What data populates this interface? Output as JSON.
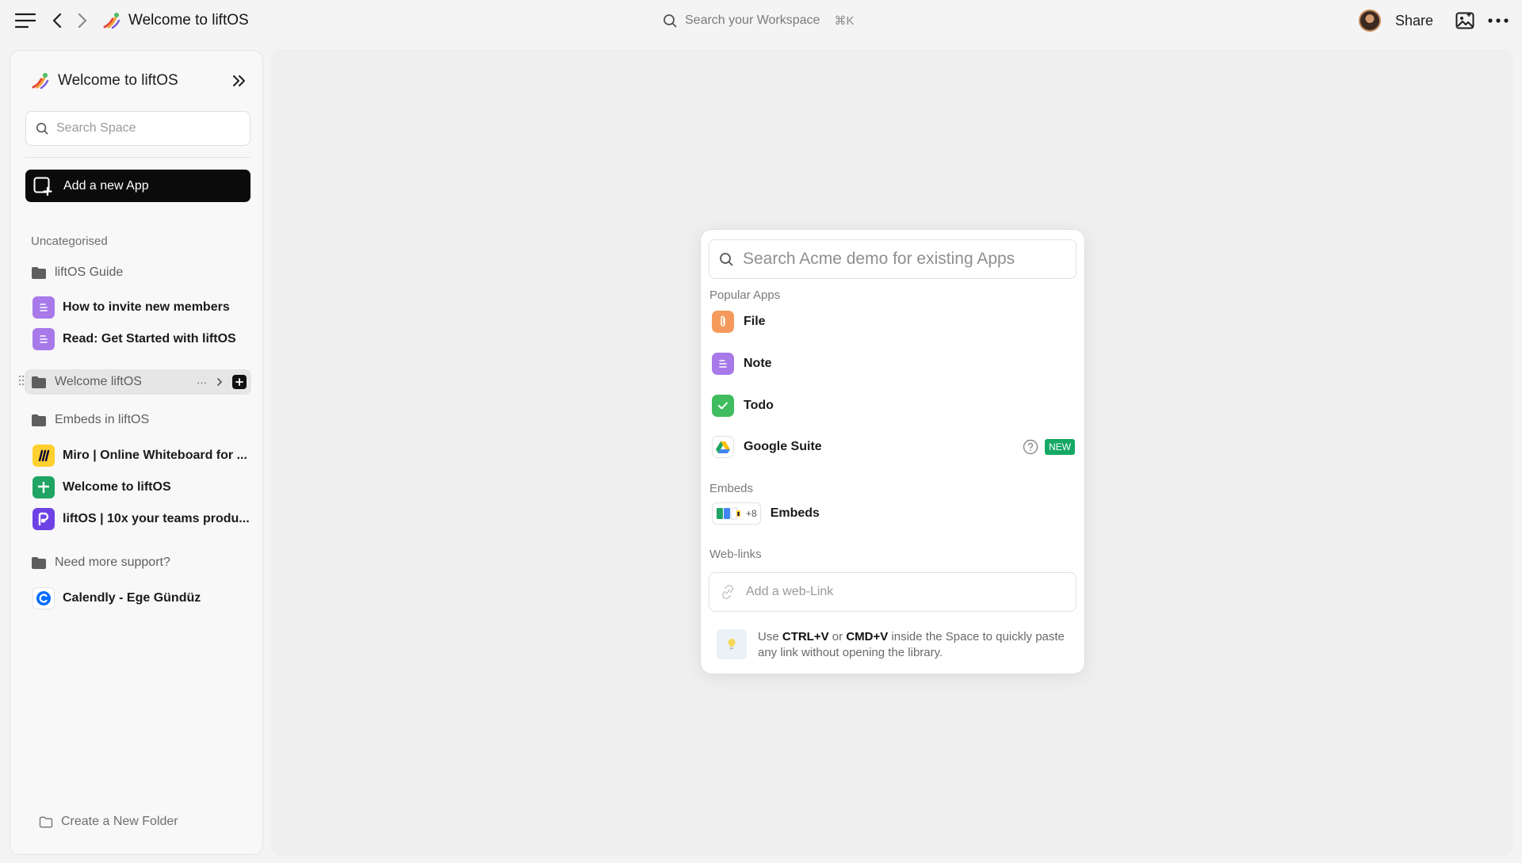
{
  "topbar": {
    "title": "Welcome to liftOS",
    "search_label": "Search your Workspace",
    "search_shortcut": "⌘K",
    "share_label": "Share"
  },
  "sidebar": {
    "title": "Welcome to liftOS",
    "search_placeholder": "Search Space",
    "add_app_label": "Add a new App",
    "section_label": "Uncategorised",
    "folders": [
      {
        "label": "liftOS Guide"
      },
      {
        "label": "Welcome liftOS",
        "actions": "···"
      },
      {
        "label": "Embeds in liftOS"
      },
      {
        "label": "Need more support?"
      }
    ],
    "items": [
      {
        "label": "How to invite new members",
        "icon": "note-icon"
      },
      {
        "label": "Read: Get Started with liftOS",
        "icon": "note-icon"
      },
      {
        "label": "Miro | Online Whiteboard for ...",
        "icon": "miro-icon"
      },
      {
        "label": "Welcome to liftOS",
        "icon": "google-sheets-icon"
      },
      {
        "label": "liftOS | 10x your teams produ...",
        "icon": "liftos-icon"
      },
      {
        "label": "Calendly - Ege Gündüz",
        "icon": "calendly-icon"
      }
    ],
    "create_folder_label": "Create a New Folder"
  },
  "library": {
    "search_placeholder": "Search Acme demo for existing Apps",
    "popular_label": "Popular Apps",
    "apps": [
      {
        "label": "File",
        "icon": "file-icon",
        "color": "#f59a5c"
      },
      {
        "label": "Note",
        "icon": "note-icon",
        "color": "#a779e9"
      },
      {
        "label": "Todo",
        "icon": "todo-icon",
        "color": "#3fbd5e"
      },
      {
        "label": "Google Suite",
        "icon": "google-drive-icon",
        "badge": "NEW"
      }
    ],
    "embeds_label": "Embeds",
    "embeds_count": "+8",
    "embeds_item_label": "Embeds",
    "weblinks_label": "Web-links",
    "weblink_placeholder": "Add a web-Link",
    "tip": {
      "use": "Use",
      "key1": "CTRL+V",
      "or": "or",
      "key2": "CMD+V",
      "rest": "inside the Space to quickly paste any link without opening the library."
    }
  },
  "colors": {
    "note": "#a779e9",
    "file": "#f59a5c",
    "todo": "#3fbd5e",
    "new_badge": "#16a865",
    "primary_button": "#0b0b0b"
  }
}
